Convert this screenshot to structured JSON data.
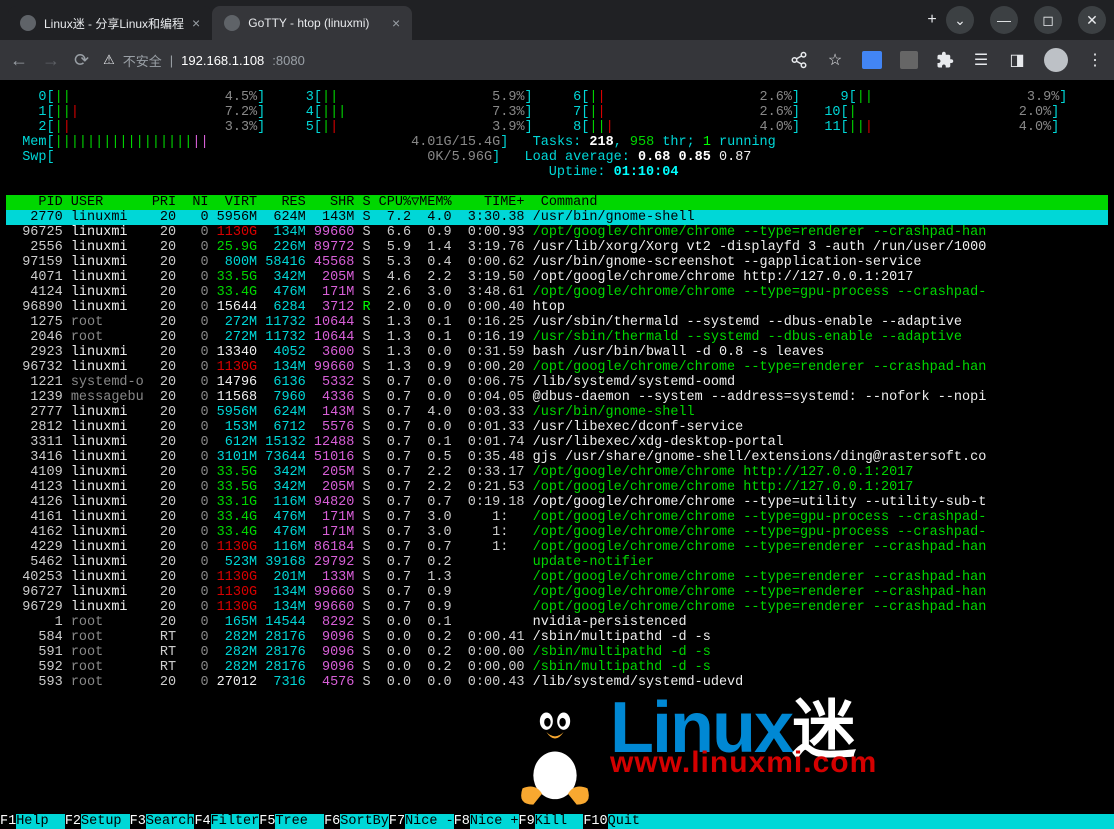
{
  "tabs": [
    {
      "title": "Linux迷 - 分享Linux和编程",
      "active": false
    },
    {
      "title": "GoTTY - htop (linuxmi)",
      "active": true
    }
  ],
  "address": {
    "warning": "不安全",
    "host": "192.168.1.108",
    "port": ":8080"
  },
  "cpu_bars": [
    {
      "n": "0",
      "pct": "4.5%"
    },
    {
      "n": "1",
      "pct": "7.2%"
    },
    {
      "n": "2",
      "pct": "3.3%"
    },
    {
      "n": "3",
      "pct": "5.9%"
    },
    {
      "n": "4",
      "pct": "7.3%"
    },
    {
      "n": "5",
      "pct": "3.9%"
    },
    {
      "n": "6",
      "pct": "2.6%"
    },
    {
      "n": "7",
      "pct": "2.6%"
    },
    {
      "n": "8",
      "pct": "4.0%"
    },
    {
      "n": "9",
      "pct": "3.9%"
    },
    {
      "n": "10",
      "pct": "2.0%"
    },
    {
      "n": "11",
      "pct": "4.0%"
    }
  ],
  "mem": {
    "label": "Mem",
    "used": "4.01G",
    "total": "15.4G"
  },
  "swp": {
    "label": "Swp",
    "used": "0K",
    "total": "5.96G"
  },
  "tasks": {
    "label": "Tasks:",
    "procs": "218",
    "thr": "958",
    "thr_lbl": "thr;",
    "running": "1",
    "running_lbl": "running"
  },
  "load": {
    "label": "Load average:",
    "v1": "0.68",
    "v2": "0.85",
    "v3": "0.87"
  },
  "uptime": {
    "label": "Uptime:",
    "value": "01:10:04"
  },
  "columns": {
    "pid": "PID",
    "user": "USER",
    "pri": "PRI",
    "ni": "NI",
    "virt": "VIRT",
    "res": "RES",
    "shr": "SHR",
    "s": "S",
    "cpu": "CPU%▽",
    "mem": "MEM%",
    "time": "TIME+",
    "cmd": "Command"
  },
  "procs": [
    {
      "pid": "2770",
      "user": "linuxmi",
      "pri": "20",
      "ni": "0",
      "virt": "5956M",
      "res": "624M",
      "shr": "143M",
      "s": "S",
      "cpu": "7.2",
      "mem": "4.0",
      "time": "3:30.38",
      "cmd": "/usr/bin/gnome-shell",
      "sel": true,
      "cc": "white"
    },
    {
      "pid": "96725",
      "user": "linuxmi",
      "pri": "20",
      "ni": "0",
      "virt": "1130G",
      "res": "134M",
      "shr": "99660",
      "s": "S",
      "cpu": "6.6",
      "mem": "0.9",
      "time": "0:00.93",
      "cmd": "/opt/google/chrome/chrome --type=renderer --crashpad-han",
      "vc": "red",
      "cc": "green"
    },
    {
      "pid": "2556",
      "user": "linuxmi",
      "pri": "20",
      "ni": "0",
      "virt": "25.9G",
      "res": "226M",
      "shr": "89772",
      "s": "S",
      "cpu": "5.9",
      "mem": "1.4",
      "time": "3:19.76",
      "cmd": "/usr/lib/xorg/Xorg vt2 -displayfd 3 -auth /run/user/1000",
      "vc": "green",
      "cc": "white"
    },
    {
      "pid": "97159",
      "user": "linuxmi",
      "pri": "20",
      "ni": "0",
      "virt": "800M",
      "res": "58416",
      "shr": "45568",
      "s": "S",
      "cpu": "5.3",
      "mem": "0.4",
      "time": "0:00.62",
      "cmd": "/usr/bin/gnome-screenshot --gapplication-service",
      "vc": "cyan",
      "cc": "white"
    },
    {
      "pid": "4071",
      "user": "linuxmi",
      "pri": "20",
      "ni": "0",
      "virt": "33.5G",
      "res": "342M",
      "shr": "205M",
      "s": "S",
      "cpu": "4.6",
      "mem": "2.2",
      "time": "3:19.50",
      "cmd": "/opt/google/chrome/chrome http://127.0.0.1:2017",
      "vc": "green",
      "cc": "white"
    },
    {
      "pid": "4124",
      "user": "linuxmi",
      "pri": "20",
      "ni": "0",
      "virt": "33.4G",
      "res": "476M",
      "shr": "171M",
      "s": "S",
      "cpu": "2.6",
      "mem": "3.0",
      "time": "3:48.61",
      "cmd": "/opt/google/chrome/chrome --type=gpu-process --crashpad-",
      "vc": "green",
      "cc": "green"
    },
    {
      "pid": "96890",
      "user": "linuxmi",
      "pri": "20",
      "ni": "0",
      "virt": "15644",
      "res": "6284",
      "shr": "3712",
      "s": "R",
      "cpu": "2.0",
      "mem": "0.0",
      "time": "0:00.40",
      "cmd": "htop",
      "vc": "white",
      "cc": "white",
      "sR": true
    },
    {
      "pid": "1275",
      "user": "root",
      "pri": "20",
      "ni": "0",
      "virt": "272M",
      "res": "11732",
      "shr": "10644",
      "s": "S",
      "cpu": "1.3",
      "mem": "0.1",
      "time": "0:16.25",
      "cmd": "/usr/sbin/thermald --systemd --dbus-enable --adaptive",
      "vc": "cyan",
      "cc": "white",
      "ur": "gray"
    },
    {
      "pid": "2046",
      "user": "root",
      "pri": "20",
      "ni": "0",
      "virt": "272M",
      "res": "11732",
      "shr": "10644",
      "s": "S",
      "cpu": "1.3",
      "mem": "0.1",
      "time": "0:16.19",
      "cmd": "/usr/sbin/thermald --systemd --dbus-enable --adaptive",
      "vc": "cyan",
      "cc": "green",
      "ur": "gray"
    },
    {
      "pid": "2923",
      "user": "linuxmi",
      "pri": "20",
      "ni": "0",
      "virt": "13340",
      "res": "4052",
      "shr": "3600",
      "s": "S",
      "cpu": "1.3",
      "mem": "0.0",
      "time": "0:31.59",
      "cmd": "bash /usr/bin/bwall -d 0.8 -s leaves",
      "vc": "white",
      "cc": "white"
    },
    {
      "pid": "96732",
      "user": "linuxmi",
      "pri": "20",
      "ni": "0",
      "virt": "1130G",
      "res": "134M",
      "shr": "99660",
      "s": "S",
      "cpu": "1.3",
      "mem": "0.9",
      "time": "0:00.20",
      "cmd": "/opt/google/chrome/chrome --type=renderer --crashpad-han",
      "vc": "red",
      "cc": "green"
    },
    {
      "pid": "1221",
      "user": "systemd-o",
      "pri": "20",
      "ni": "0",
      "virt": "14796",
      "res": "6136",
      "shr": "5332",
      "s": "S",
      "cpu": "0.7",
      "mem": "0.0",
      "time": "0:06.75",
      "cmd": "/lib/systemd/systemd-oomd",
      "vc": "white",
      "cc": "white",
      "ur": "gray"
    },
    {
      "pid": "1239",
      "user": "messagebu",
      "pri": "20",
      "ni": "0",
      "virt": "11568",
      "res": "7960",
      "shr": "4336",
      "s": "S",
      "cpu": "0.7",
      "mem": "0.0",
      "time": "0:04.05",
      "cmd": "@dbus-daemon --system --address=systemd: --nofork --nopi",
      "vc": "white",
      "cc": "white",
      "ur": "gray"
    },
    {
      "pid": "2777",
      "user": "linuxmi",
      "pri": "20",
      "ni": "0",
      "virt": "5956M",
      "res": "624M",
      "shr": "143M",
      "s": "S",
      "cpu": "0.7",
      "mem": "4.0",
      "time": "0:03.33",
      "cmd": "/usr/bin/gnome-shell",
      "vc": "cyan",
      "cc": "green"
    },
    {
      "pid": "2812",
      "user": "linuxmi",
      "pri": "20",
      "ni": "0",
      "virt": "153M",
      "res": "6712",
      "shr": "5576",
      "s": "S",
      "cpu": "0.7",
      "mem": "0.0",
      "time": "0:01.33",
      "cmd": "/usr/libexec/dconf-service",
      "vc": "cyan",
      "cc": "white"
    },
    {
      "pid": "3311",
      "user": "linuxmi",
      "pri": "20",
      "ni": "0",
      "virt": "612M",
      "res": "15132",
      "shr": "12488",
      "s": "S",
      "cpu": "0.7",
      "mem": "0.1",
      "time": "0:01.74",
      "cmd": "/usr/libexec/xdg-desktop-portal",
      "vc": "cyan",
      "cc": "white"
    },
    {
      "pid": "3416",
      "user": "linuxmi",
      "pri": "20",
      "ni": "0",
      "virt": "3101M",
      "res": "73644",
      "shr": "51016",
      "s": "S",
      "cpu": "0.7",
      "mem": "0.5",
      "time": "0:35.48",
      "cmd": "gjs /usr/share/gnome-shell/extensions/ding@rastersoft.co",
      "vc": "cyan",
      "cc": "white"
    },
    {
      "pid": "4109",
      "user": "linuxmi",
      "pri": "20",
      "ni": "0",
      "virt": "33.5G",
      "res": "342M",
      "shr": "205M",
      "s": "S",
      "cpu": "0.7",
      "mem": "2.2",
      "time": "0:33.17",
      "cmd": "/opt/google/chrome/chrome http://127.0.0.1:2017",
      "vc": "green",
      "cc": "green"
    },
    {
      "pid": "4123",
      "user": "linuxmi",
      "pri": "20",
      "ni": "0",
      "virt": "33.5G",
      "res": "342M",
      "shr": "205M",
      "s": "S",
      "cpu": "0.7",
      "mem": "2.2",
      "time": "0:21.53",
      "cmd": "/opt/google/chrome/chrome http://127.0.0.1:2017",
      "vc": "green",
      "cc": "green"
    },
    {
      "pid": "4126",
      "user": "linuxmi",
      "pri": "20",
      "ni": "0",
      "virt": "33.1G",
      "res": "116M",
      "shr": "94820",
      "s": "S",
      "cpu": "0.7",
      "mem": "0.7",
      "time": "0:19.18",
      "cmd": "/opt/google/chrome/chrome --type=utility --utility-sub-t",
      "vc": "green",
      "cc": "white"
    },
    {
      "pid": "4161",
      "user": "linuxmi",
      "pri": "20",
      "ni": "0",
      "virt": "33.4G",
      "res": "476M",
      "shr": "171M",
      "s": "S",
      "cpu": "0.7",
      "mem": "3.0",
      "time": "1:  ",
      "cmd": "/opt/google/chrome/chrome --type=gpu-process --crashpad-",
      "vc": "green",
      "cc": "green"
    },
    {
      "pid": "4162",
      "user": "linuxmi",
      "pri": "20",
      "ni": "0",
      "virt": "33.4G",
      "res": "476M",
      "shr": "171M",
      "s": "S",
      "cpu": "0.7",
      "mem": "3.0",
      "time": "1:  ",
      "cmd": "/opt/google/chrome/chrome --type=gpu-process --crashpad-",
      "vc": "green",
      "cc": "green"
    },
    {
      "pid": "4229",
      "user": "linuxmi",
      "pri": "20",
      "ni": "0",
      "virt": "1130G",
      "res": "116M",
      "shr": "86184",
      "s": "S",
      "cpu": "0.7",
      "mem": "0.7",
      "time": "1:  ",
      "cmd": "/opt/google/chrome/chrome --type=renderer --crashpad-han",
      "vc": "red",
      "cc": "green"
    },
    {
      "pid": "5462",
      "user": "linuxmi",
      "pri": "20",
      "ni": "0",
      "virt": "523M",
      "res": "39168",
      "shr": "29792",
      "s": "S",
      "cpu": "0.7",
      "mem": "0.2",
      "time": "   ",
      "cmd": "update-notifier",
      "vc": "cyan",
      "cc": "green"
    },
    {
      "pid": "40253",
      "user": "linuxmi",
      "pri": "20",
      "ni": "0",
      "virt": "1130G",
      "res": "201M",
      "shr": "133M",
      "s": "S",
      "cpu": "0.7",
      "mem": "1.3",
      "time": "   ",
      "cmd": "/opt/google/chrome/chrome --type=renderer --crashpad-han",
      "vc": "red",
      "cc": "green"
    },
    {
      "pid": "96727",
      "user": "linuxmi",
      "pri": "20",
      "ni": "0",
      "virt": "1130G",
      "res": "134M",
      "shr": "99660",
      "s": "S",
      "cpu": "0.7",
      "mem": "0.9",
      "time": "   ",
      "cmd": "/opt/google/chrome/chrome --type=renderer --crashpad-han",
      "vc": "red",
      "cc": "green"
    },
    {
      "pid": "96729",
      "user": "linuxmi",
      "pri": "20",
      "ni": "0",
      "virt": "1130G",
      "res": "134M",
      "shr": "99660",
      "s": "S",
      "cpu": "0.7",
      "mem": "0.9",
      "time": "   ",
      "cmd": "/opt/google/chrome/chrome --type=renderer --crashpad-han",
      "vc": "red",
      "cc": "green"
    },
    {
      "pid": "1",
      "user": "root",
      "pri": "20",
      "ni": "0",
      "virt": "165M",
      "res": "14544",
      "shr": "8292",
      "s": "S",
      "cpu": "0.0",
      "mem": "0.1",
      "time": "   ",
      "cmd": "nvidia-persistenced",
      "vc": "cyan",
      "cc": "white",
      "ur": "gray"
    },
    {
      "pid": "584",
      "user": "root",
      "pri": "RT",
      "ni": "0",
      "virt": "282M",
      "res": "28176",
      "shr": "9096",
      "s": "S",
      "cpu": "0.0",
      "mem": "0.2",
      "time": "0:00.41",
      "cmd": "/sbin/multipathd -d -s",
      "vc": "cyan",
      "cc": "white",
      "ur": "gray"
    },
    {
      "pid": "591",
      "user": "root",
      "pri": "RT",
      "ni": "0",
      "virt": "282M",
      "res": "28176",
      "shr": "9096",
      "s": "S",
      "cpu": "0.0",
      "mem": "0.2",
      "time": "0:00.00",
      "cmd": "/sbin/multipathd -d -s",
      "vc": "cyan",
      "cc": "green",
      "ur": "gray"
    },
    {
      "pid": "592",
      "user": "root",
      "pri": "RT",
      "ni": "0",
      "virt": "282M",
      "res": "28176",
      "shr": "9096",
      "s": "S",
      "cpu": "0.0",
      "mem": "0.2",
      "time": "0:00.00",
      "cmd": "/sbin/multipathd -d -s",
      "vc": "cyan",
      "cc": "green",
      "ur": "gray"
    },
    {
      "pid": "593",
      "user": "root",
      "pri": "20",
      "ni": "0",
      "virt": "27012",
      "res": "7316",
      "shr": "4576",
      "s": "S",
      "cpu": "0.0",
      "mem": "0.0",
      "time": "0:00.43",
      "cmd": "/lib/systemd/systemd-udevd",
      "vc": "white",
      "cc": "white",
      "ur": "gray"
    }
  ],
  "fn": [
    {
      "k": "F1",
      "l": "Help  "
    },
    {
      "k": "F2",
      "l": "Setup "
    },
    {
      "k": "F3",
      "l": "Search"
    },
    {
      "k": "F4",
      "l": "Filter"
    },
    {
      "k": "F5",
      "l": "Tree  "
    },
    {
      "k": "F6",
      "l": "SortBy"
    },
    {
      "k": "F7",
      "l": "Nice -"
    },
    {
      "k": "F8",
      "l": "Nice +"
    },
    {
      "k": "F9",
      "l": "Kill  "
    },
    {
      "k": "F10",
      "l": "Quit  "
    }
  ],
  "watermark": {
    "big": "Linux",
    "mi": "迷",
    "url": "www.linuxmi.com"
  }
}
